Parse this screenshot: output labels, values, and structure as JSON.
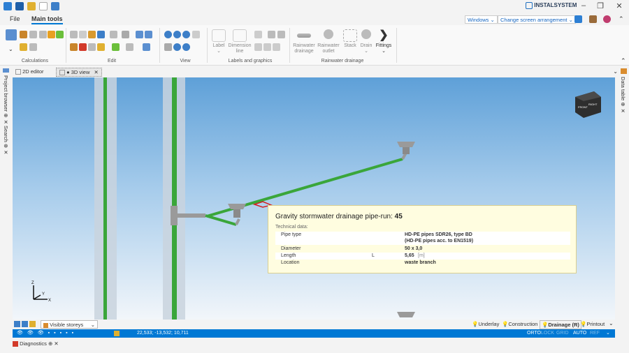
{
  "app": {
    "brand": "INSTALSYSTEM"
  },
  "menu": {
    "file": "File",
    "main_tools": "Main tools"
  },
  "topbar": {
    "windows": "Windows",
    "change_arrangement": "Change screen arrangement"
  },
  "ribbon": {
    "groups": {
      "calculations": "Calculations",
      "edit": "Edit",
      "view": "View",
      "labels_graphics": "Labels and graphics",
      "rainwater_drainage": "Rainwater drainage"
    },
    "buttons": {
      "label": "Label",
      "dimension_line": "Dimension line",
      "rainwater_drainage": "Rainwater drainage",
      "rainwater_outlet": "Rainwater outlet",
      "stack": "Stack",
      "drain": "Drain",
      "fittings": "Fittings"
    }
  },
  "doc_tabs": {
    "editor_2d": "2D editor",
    "view_3d": "● 3D view"
  },
  "docks": {
    "project_browser": "Project browser",
    "search": "Search",
    "data_table": "Data table"
  },
  "nav_cube": {
    "front": "FRONT",
    "right": "RIGHT"
  },
  "tooltip": {
    "title_prefix": "Gravity stormwater drainage pipe-run:",
    "title_number": "45",
    "section": "Technical data:",
    "rows": [
      {
        "label": "Pipe type",
        "symbol": "",
        "value": "HD-PE pipes SDR26, type BD",
        "value2": "(HD-PE pipes acc. to EN1519)",
        "unit": ""
      },
      {
        "label": "Diameter",
        "symbol": "",
        "value": "50 x 3,0",
        "unit": ""
      },
      {
        "label": "Length",
        "symbol": "L",
        "value": "5,65",
        "unit": "[m]"
      },
      {
        "label": "Location",
        "symbol": "",
        "value": "waste branch",
        "unit": ""
      }
    ]
  },
  "axes": {
    "z": "Z",
    "y": "Y",
    "x": "X"
  },
  "bottom": {
    "visible_storeys": "Visible storeys",
    "underlay": "Underlay",
    "construction": "Construction",
    "drainage": "Drainage (R)",
    "printout": "Printout"
  },
  "status": {
    "coords": "22,533; -13,532; 10,711",
    "orto": "ORTO",
    "lock": "LOCK",
    "grid": "GRID",
    "auto": "AUTO",
    "ref": "REF"
  },
  "diagnostics": "Diagnostics",
  "colors": {
    "accent": "#0078d4",
    "pipe_green": "#3aa63a",
    "tooltip_bg": "#fffde0"
  }
}
